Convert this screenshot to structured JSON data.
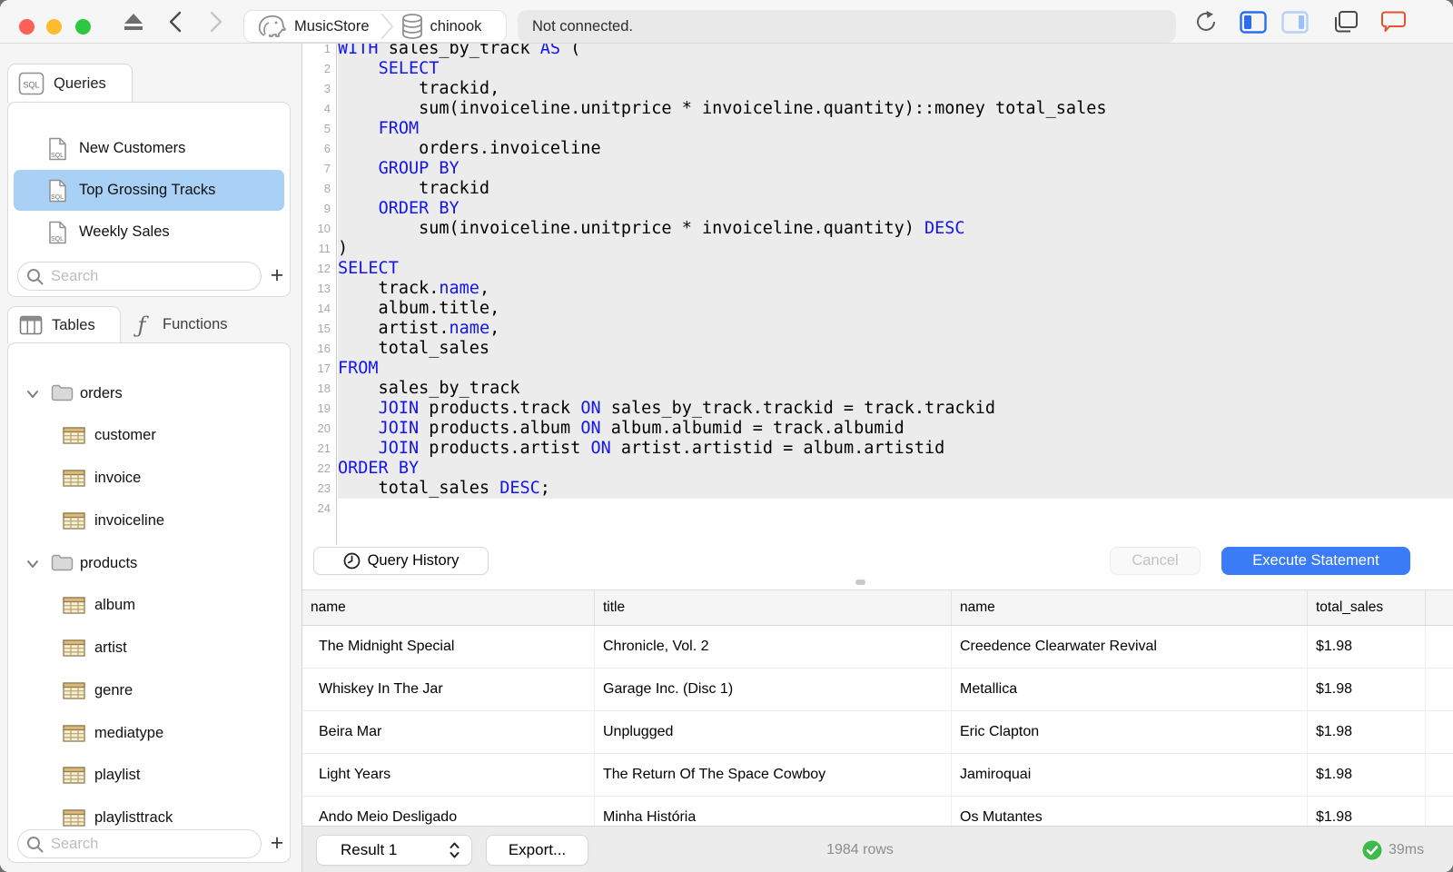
{
  "titlebar": {
    "breadcrumb_app": "MusicStore",
    "breadcrumb_db": "chinook",
    "status": "Not connected."
  },
  "queries_panel": {
    "tab": "Queries",
    "items": [
      {
        "label": "New Customers",
        "selected": false
      },
      {
        "label": "Top Grossing Tracks",
        "selected": true
      },
      {
        "label": "Weekly Sales",
        "selected": false
      }
    ],
    "search_placeholder": "Search",
    "add_label": "+"
  },
  "tables_panel": {
    "tab_tables": "Tables",
    "tab_functions": "Functions",
    "tree": [
      {
        "kind": "folder",
        "label": "orders",
        "expanded": true
      },
      {
        "kind": "table",
        "label": "customer"
      },
      {
        "kind": "table",
        "label": "invoice"
      },
      {
        "kind": "table",
        "label": "invoiceline"
      },
      {
        "kind": "folder",
        "label": "products",
        "expanded": true
      },
      {
        "kind": "table",
        "label": "album"
      },
      {
        "kind": "table",
        "label": "artist"
      },
      {
        "kind": "table",
        "label": "genre"
      },
      {
        "kind": "table",
        "label": "mediatype"
      },
      {
        "kind": "table",
        "label": "playlist"
      },
      {
        "kind": "table",
        "label": "playlisttrack"
      }
    ],
    "search_placeholder": "Search",
    "add_label": "+"
  },
  "editor": {
    "lines": [
      {
        "n": 1,
        "seg": [
          [
            "k",
            "WITH"
          ],
          [
            "p",
            " sales_by_track "
          ],
          [
            "k",
            "AS"
          ],
          [
            "p",
            " ("
          ]
        ]
      },
      {
        "n": 2,
        "seg": [
          [
            "p",
            "    "
          ],
          [
            "k",
            "SELECT"
          ]
        ]
      },
      {
        "n": 3,
        "seg": [
          [
            "p",
            "        trackid,"
          ]
        ]
      },
      {
        "n": 4,
        "seg": [
          [
            "p",
            "        sum(invoiceline.unitprice * invoiceline.quantity)::money total_sales"
          ]
        ]
      },
      {
        "n": 5,
        "seg": [
          [
            "p",
            "    "
          ],
          [
            "k",
            "FROM"
          ]
        ]
      },
      {
        "n": 6,
        "seg": [
          [
            "p",
            "        orders.invoiceline"
          ]
        ]
      },
      {
        "n": 7,
        "seg": [
          [
            "p",
            "    "
          ],
          [
            "k",
            "GROUP BY"
          ]
        ]
      },
      {
        "n": 8,
        "seg": [
          [
            "p",
            "        trackid"
          ]
        ]
      },
      {
        "n": 9,
        "seg": [
          [
            "p",
            "    "
          ],
          [
            "k",
            "ORDER BY"
          ]
        ]
      },
      {
        "n": 10,
        "seg": [
          [
            "p",
            "        sum(invoiceline.unitprice * invoiceline.quantity) "
          ],
          [
            "k",
            "DESC"
          ]
        ]
      },
      {
        "n": 11,
        "seg": [
          [
            "p",
            ")"
          ]
        ]
      },
      {
        "n": 12,
        "seg": [
          [
            "k",
            "SELECT"
          ]
        ]
      },
      {
        "n": 13,
        "seg": [
          [
            "p",
            "    track."
          ],
          [
            "k",
            "name"
          ],
          [
            "p",
            ","
          ]
        ]
      },
      {
        "n": 14,
        "seg": [
          [
            "p",
            "    album.title,"
          ]
        ]
      },
      {
        "n": 15,
        "seg": [
          [
            "p",
            "    artist."
          ],
          [
            "k",
            "name"
          ],
          [
            "p",
            ","
          ]
        ]
      },
      {
        "n": 16,
        "seg": [
          [
            "p",
            "    total_sales"
          ]
        ]
      },
      {
        "n": 17,
        "seg": [
          [
            "k",
            "FROM"
          ]
        ]
      },
      {
        "n": 18,
        "seg": [
          [
            "p",
            "    sales_by_track"
          ]
        ]
      },
      {
        "n": 19,
        "seg": [
          [
            "p",
            "    "
          ],
          [
            "k",
            "JOIN"
          ],
          [
            "p",
            " products.track "
          ],
          [
            "k",
            "ON"
          ],
          [
            "p",
            " sales_by_track.trackid = track.trackid"
          ]
        ]
      },
      {
        "n": 20,
        "seg": [
          [
            "p",
            "    "
          ],
          [
            "k",
            "JOIN"
          ],
          [
            "p",
            " products.album "
          ],
          [
            "k",
            "ON"
          ],
          [
            "p",
            " album.albumid = track.albumid"
          ]
        ]
      },
      {
        "n": 21,
        "seg": [
          [
            "p",
            "    "
          ],
          [
            "k",
            "JOIN"
          ],
          [
            "p",
            " products.artist "
          ],
          [
            "k",
            "ON"
          ],
          [
            "p",
            " artist.artistid = album.artistid"
          ]
        ]
      },
      {
        "n": 22,
        "seg": [
          [
            "k",
            "ORDER BY"
          ]
        ]
      },
      {
        "n": 23,
        "seg": [
          [
            "p",
            "    total_sales "
          ],
          [
            "k",
            "DESC"
          ],
          [
            "p",
            ";"
          ]
        ]
      },
      {
        "n": 24,
        "seg": []
      }
    ],
    "query_history": "Query History",
    "cancel": "Cancel",
    "execute": "Execute Statement"
  },
  "results": {
    "columns": [
      "name",
      "title",
      "name",
      "total_sales"
    ],
    "rows": [
      [
        "The Midnight Special",
        "Chronicle, Vol. 2",
        "Creedence Clearwater Revival",
        "$1.98"
      ],
      [
        "Whiskey In The Jar",
        "Garage Inc. (Disc 1)",
        "Metallica",
        "$1.98"
      ],
      [
        "Beira Mar",
        "Unplugged",
        "Eric Clapton",
        "$1.98"
      ],
      [
        "Light Years",
        "The Return Of The Space Cowboy",
        "Jamiroquai",
        "$1.98"
      ],
      [
        "Ando Meio Desligado",
        "Minha História",
        "Os Mutantes",
        "$1.98"
      ]
    ],
    "result_selector": "Result 1",
    "export": "Export...",
    "row_count": "1984 rows",
    "duration": "39ms"
  },
  "colors": {
    "accent_blue": "#3a7bf6",
    "selection_blue": "#a9d0f5",
    "keyword_blue": "#1414f0",
    "success_green": "#3eb94c",
    "chat_orange": "#e8502a",
    "table_icon_tan": "#ddba7a"
  }
}
